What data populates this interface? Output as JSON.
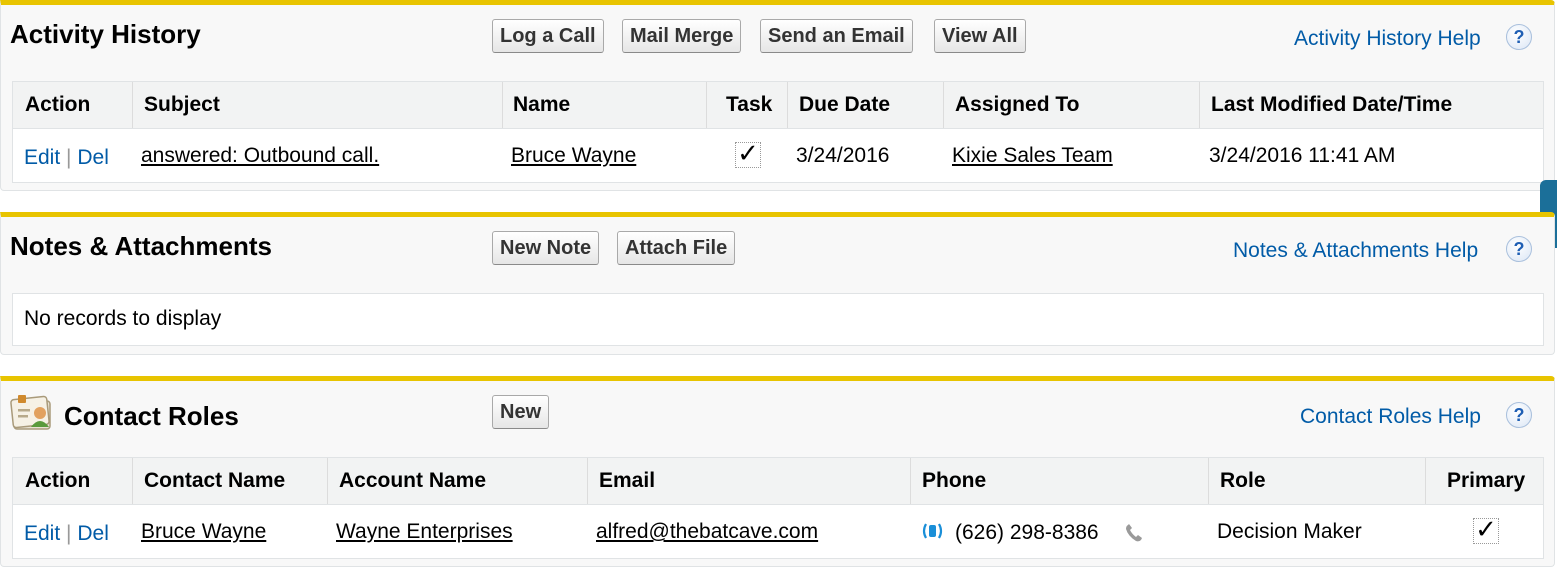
{
  "activity_history": {
    "title": "Activity History",
    "buttons": [
      "Log a Call",
      "Mail Merge",
      "Send an Email",
      "View All"
    ],
    "help_label": "Activity History Help",
    "help_icon": "?",
    "columns": [
      "Action",
      "Subject",
      "Name",
      "Task",
      "Due Date",
      "Assigned To",
      "Last Modified Date/Time"
    ],
    "rows": [
      {
        "edit": "Edit",
        "sep": "|",
        "del": "Del",
        "subject": "answered: Outbound call.",
        "name": "Bruce Wayne",
        "task": "✓",
        "due_date": "3/24/2016",
        "assigned_to": "Kixie Sales Team",
        "last_modified": "3/24/2016 11:41 AM"
      }
    ]
  },
  "notes_attachments": {
    "title": "Notes & Attachments",
    "buttons": [
      "New Note",
      "Attach File"
    ],
    "help_label": "Notes & Attachments Help",
    "help_icon": "?",
    "empty_message": "No records to display"
  },
  "contact_roles": {
    "title": "Contact Roles",
    "buttons": [
      "New"
    ],
    "help_label": "Contact Roles Help",
    "help_icon": "?",
    "section_icon": "contact-card-icon",
    "columns": [
      "Action",
      "Contact Name",
      "Account Name",
      "Email",
      "Phone",
      "Role",
      "Primary"
    ],
    "rows": [
      {
        "edit": "Edit",
        "sep": "|",
        "del": "Del",
        "contact_name": "Bruce Wayne",
        "account_name": "Wayne Enterprises",
        "email": "alfred@thebatcave.com",
        "phone": "(626) 298-8386",
        "role": "Decision Maker",
        "primary": "✓"
      }
    ]
  },
  "colors": {
    "accent_border": "#e8c400",
    "link": "#015ba7",
    "side_tab": "#1b6f99"
  }
}
